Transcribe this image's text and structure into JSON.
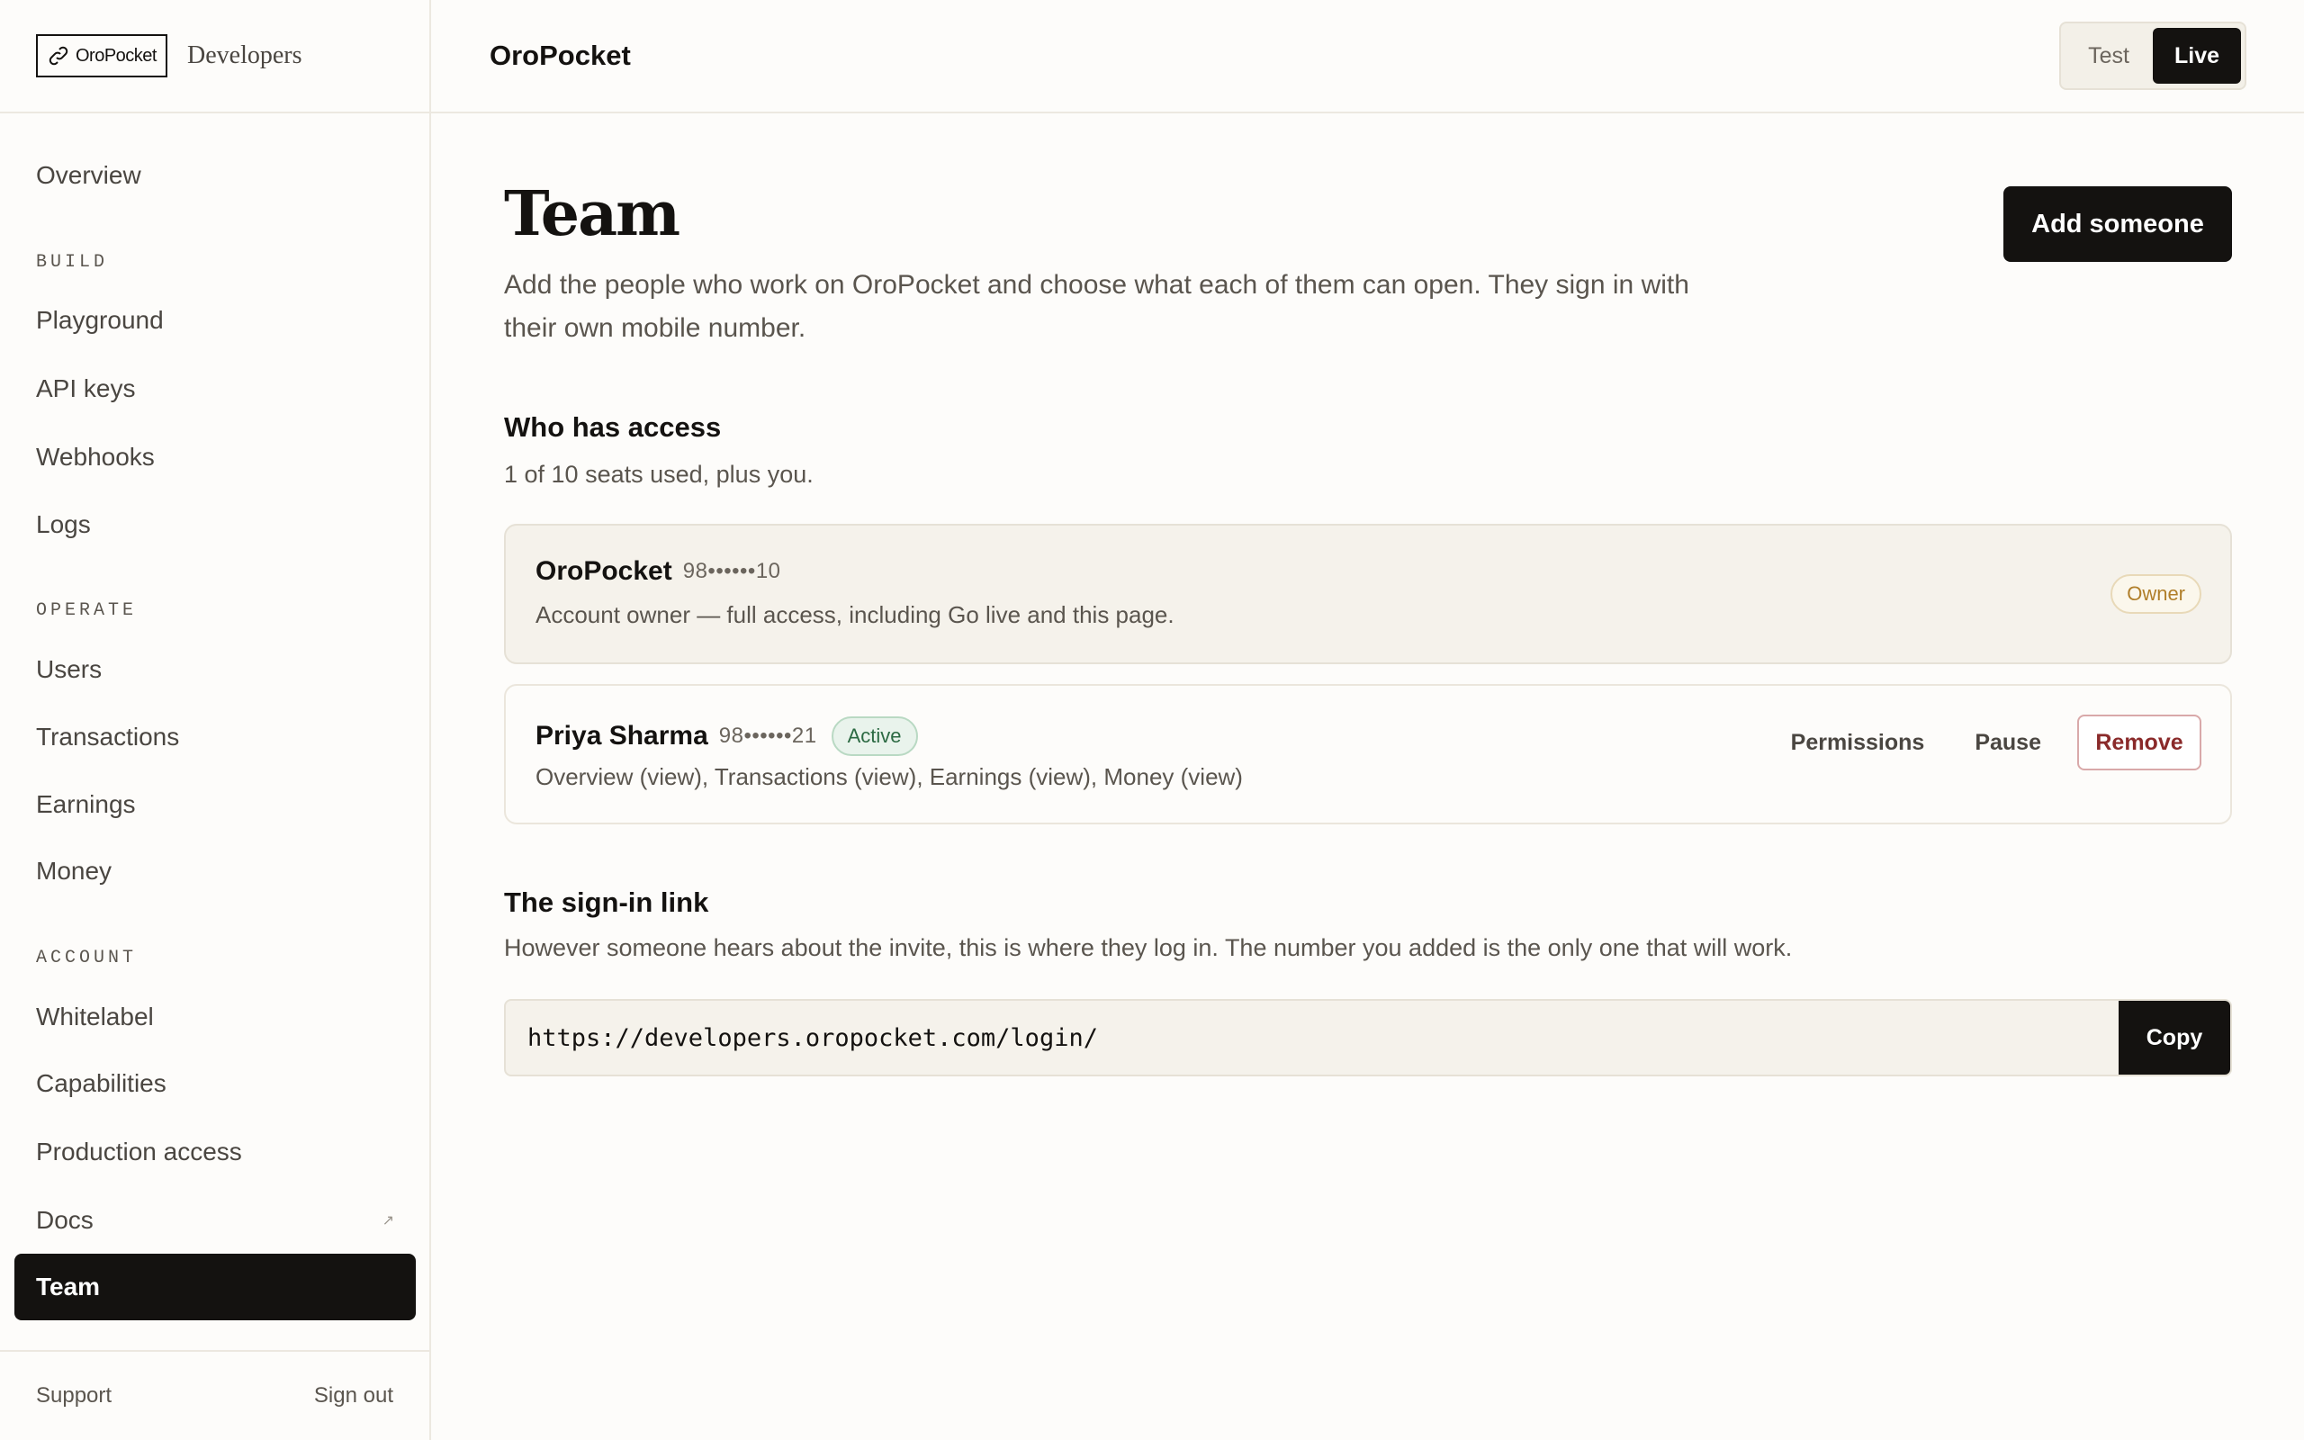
{
  "brand": {
    "logo_text": "OroPocket",
    "subtitle": "Developers"
  },
  "sidebar": {
    "overview": "Overview",
    "sections": {
      "build": "BUILD",
      "operate": "OPERATE",
      "account": "ACCOUNT"
    },
    "build_items": [
      "Playground",
      "API keys",
      "Webhooks",
      "Logs"
    ],
    "operate_items": [
      "Users",
      "Transactions",
      "Earnings",
      "Money"
    ],
    "account_items": [
      "Whitelabel",
      "Capabilities",
      "Production access",
      "Docs",
      "Team"
    ],
    "docs_external_glyph": "↗",
    "active_item": "Team",
    "footer": {
      "support": "Support",
      "sign_out": "Sign out"
    }
  },
  "topbar": {
    "title": "OroPocket",
    "mode": {
      "test": "Test",
      "live": "Live",
      "selected": "Live"
    }
  },
  "page": {
    "title": "Team",
    "description": "Add the people who work on OroPocket and choose what each of them can open. They sign in with their own mobile number.",
    "add_button": "Add someone"
  },
  "access": {
    "heading": "Who has access",
    "seats": "1 of 10 seats used, plus you.",
    "members": [
      {
        "name": "OroPocket",
        "number": "98••••••10",
        "description": "Account owner — full access, including Go live and this page.",
        "badge": "Owner"
      },
      {
        "name": "Priya Sharma",
        "number": "98••••••21",
        "status": "Active",
        "description": "Overview (view), Transactions (view), Earnings (view), Money (view)",
        "actions": {
          "permissions": "Permissions",
          "pause": "Pause",
          "remove": "Remove"
        }
      }
    ]
  },
  "signin": {
    "heading": "The sign-in link",
    "description": "However someone hears about the invite, this is where they log in. The number you added is the only one that will work.",
    "url": "https://developers.oropocket.com/login/",
    "copy_button": "Copy"
  },
  "colors": {
    "accent": "#141210",
    "background": "#fdfcfa",
    "owner_badge": "#b07e2a",
    "active_badge": "#2c6a43",
    "danger": "#8a2a2a"
  }
}
